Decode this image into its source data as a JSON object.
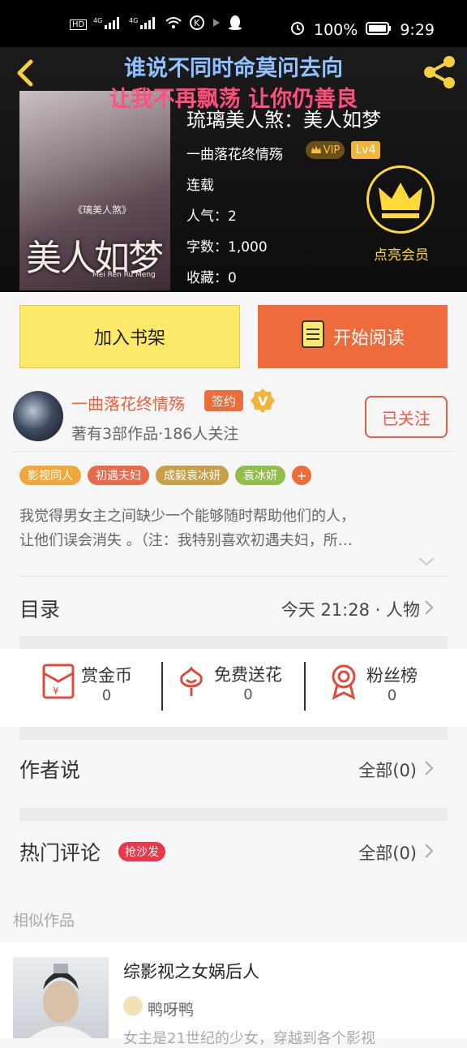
{
  "status_bar": {
    "left_icons": [
      "HD",
      "4G",
      "4G",
      "wifi-icon",
      "k-icon",
      "qq-icon"
    ],
    "battery": "100%",
    "time": "9:29"
  },
  "header": {
    "lyric_line1": "谁说不同时命莫问去向",
    "lyric_line2": "让我不再飘荡 让你仍善良",
    "cover_title": "美人如梦",
    "cover_subtitle": "《璃美人煞》",
    "cover_pinyin": "Mei Ren Ru Meng",
    "book_title": "琉璃美人煞：美人如梦",
    "author": "一曲落花终情殇",
    "vip": "VIP",
    "level": "Lv4",
    "status": "连载",
    "popularity": "人气：2",
    "word_count": "字数：1,000",
    "favorites": "收藏：0",
    "member_label": "点亮会员"
  },
  "actions": {
    "add_shelf": "加入书架",
    "start_reading": "开始阅读"
  },
  "author_section": {
    "name": "一曲落花终情殇",
    "signed": "签约",
    "v": "V",
    "stats": "著有3部作品·186人关注",
    "follow": "已关注"
  },
  "tags": [
    {
      "label": "影视同人",
      "color": "#f0a73a"
    },
    {
      "label": "初遇夫妇",
      "color": "#e86a4a"
    },
    {
      "label": "成毅袁冰妍",
      "color": "#c9a04a"
    },
    {
      "label": "袁冰妍",
      "color": "#8fbf4a"
    }
  ],
  "tag_more": "+",
  "description": {
    "line1": "我觉得男女主之间缺少一个能够随时帮助他们的人，",
    "line2": "让他们误会消失 。（注：我特别喜欢初遇夫妇，所…"
  },
  "catalog": {
    "title": "目录",
    "latest": "今天 21:28 · 人物"
  },
  "rewards": [
    {
      "label": "赏金币",
      "value": "0",
      "icon": "red-envelope-icon"
    },
    {
      "label": "免费送花",
      "value": "0",
      "icon": "flower-icon"
    },
    {
      "label": "粉丝榜",
      "value": "0",
      "icon": "medal-icon"
    }
  ],
  "author_says": {
    "title": "作者说",
    "all": "全部(0)"
  },
  "hot_comments": {
    "title": "热门评论",
    "badge": "抢沙发",
    "all": "全部(0)"
  },
  "similar": {
    "label": "相似作品",
    "title": "综影视之女娲后人",
    "author": "鸭呀鸭",
    "desc": "女主是21世纪的少女，穿越到各个影视"
  }
}
